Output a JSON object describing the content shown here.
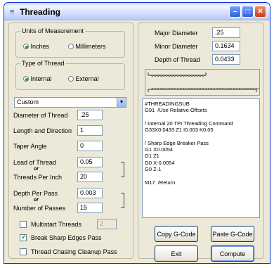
{
  "window": {
    "title": "Threading"
  },
  "units": {
    "group_label": "Units of Measurement",
    "options": [
      "Inches",
      "Millimeters"
    ],
    "selected": "Inches"
  },
  "thread_type": {
    "group_label": "Type of Thread",
    "options": [
      "Internal",
      "External"
    ],
    "selected": "Internal"
  },
  "preset": {
    "value": "Custom"
  },
  "fields": {
    "diameter": {
      "label": "Diameter of Thread",
      "value": ".25"
    },
    "length": {
      "label": "Length and Direction",
      "value": "1"
    },
    "taper": {
      "label": "Taper Angle",
      "value": "0"
    },
    "lead": {
      "label": "Lead of Thread",
      "value": "0.05"
    },
    "tpi": {
      "label": "Threads Per Inch",
      "value": "20"
    },
    "depth_per_pass": {
      "label": "Depth Per Pass",
      "value": "0.003"
    },
    "passes": {
      "label": "Number of Passes",
      "value": "15"
    },
    "or_label": "or"
  },
  "options": {
    "multistart": {
      "label": "Multistart Threads",
      "value": "2",
      "checked": false
    },
    "break_edges": {
      "label": "Break Sharp Edges Pass",
      "checked": true
    },
    "chasing": {
      "label": "Thread Chasing Cleanup Pass",
      "checked": false
    }
  },
  "results": {
    "major": {
      "label": "Major Diameter",
      "value": ".25"
    },
    "minor": {
      "label": "Minor Diameter",
      "value": "0.1634"
    },
    "depth": {
      "label": "Depth of Thread",
      "value": "0.0433"
    }
  },
  "gcode": [
    "#THREADINGSUB",
    "G91  /Use Relative Offsets",
    "",
    "/ Internal 20 TPI Threading Command",
    "G33X0.0433 Z1 I0.003 K0.05",
    "",
    "/ Sharp Edge Breaker Pass",
    "G1 X0.0054",
    "G1 Z1",
    "G0 X-0.0054",
    "G0 Z-1",
    "",
    "M17  /Return"
  ],
  "buttons": {
    "copy": "Copy G-Code",
    "paste": "Paste G-Code",
    "exit": "Exit",
    "compute": "Compute"
  },
  "icons": {
    "app": "thread-icon",
    "minimize": "minimize-icon",
    "maximize": "maximize-icon",
    "close": "close-icon",
    "dropdown": "chevron-down-icon"
  }
}
